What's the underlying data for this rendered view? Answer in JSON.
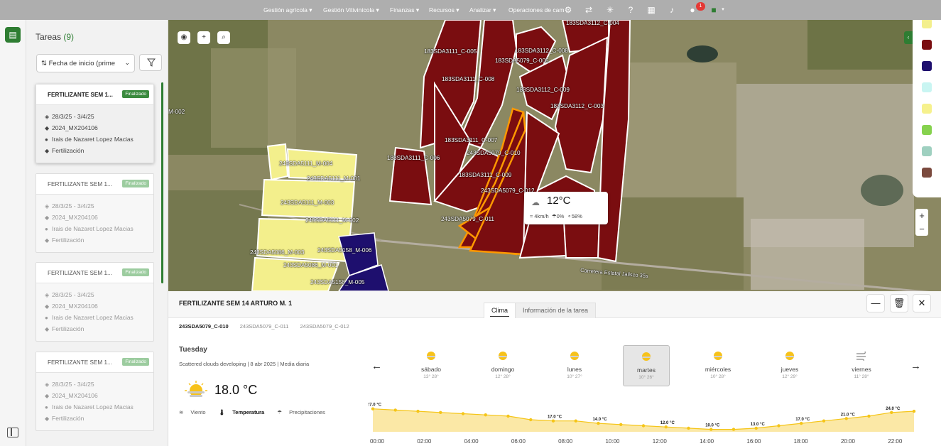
{
  "nav": {
    "items": [
      "Gestión agrícola",
      "Gestión Vitivinícola",
      "Finanzas",
      "Recursos",
      "Analizar",
      "Operaciones de cam"
    ],
    "notification_count": "1"
  },
  "tasks": {
    "title": "Tareas",
    "count": "(9)",
    "sort_label": "Fecha de inicio (prime",
    "cards": [
      {
        "name": "FERTILIZANTE SEM 1...",
        "status": "Finalizado",
        "dates": "28/3/25 - 3/4/25",
        "code": "2024_MX204106",
        "person": "Irais de Nazaret Lopez Macias",
        "type": "Fertilización"
      },
      {
        "name": "FERTILIZANTE SEM 1...",
        "status": "Finalizado",
        "dates": "28/3/25 - 3/4/25",
        "code": "2024_MX204106",
        "person": "Irais de Nazaret Lopez Macias",
        "type": "Fertilización"
      },
      {
        "name": "FERTILIZANTE SEM 1...",
        "status": "Finalizado",
        "dates": "28/3/25 - 3/4/25",
        "code": "2024_MX204106",
        "person": "Irais de Nazaret Lopez Macias",
        "type": "Fertilización"
      },
      {
        "name": "FERTILIZANTE SEM 1...",
        "status": "Finalizado",
        "dates": "28/3/25 - 3/4/25",
        "code": "2024_MX204106",
        "person": "Irais de Nazaret Lopez Macias",
        "type": "Fertilización"
      }
    ]
  },
  "map": {
    "labels": [
      "183SDA3112_C-004",
      "183SDA3111_C-005",
      "183SDA3112_C-008",
      "183SDA5079_C-005",
      "183SDA3111_C-008",
      "183SDA3112_C-009",
      "183SDA3112_C-003",
      "183SDA3111_C-007",
      "243SDA5079_C-010",
      "183SDA3111_C-006",
      "183SDA3111_C-009",
      "243SDA5079_C-012",
      "243SDA5079_C-011",
      "243SDA5111_M-004",
      "243SDA5111_M-001",
      "243SDA5111_M-003",
      "243SDA5111_M-002",
      "243SDA5086_M-003",
      "243SDA5158_M-006",
      "243SDA5086_M-001",
      "243SDA5158_M-005",
      "Carretera Estatal Jalisco 35s",
      "M-002"
    ],
    "legend_colors": [
      "#f3ef8c",
      "#7a0d10",
      "#1e0f6e",
      "#c9f5f2",
      "#f6f18d",
      "#86d24e",
      "#9fd0c0",
      "#7b4a3e"
    ],
    "weather": {
      "temp": "12°C",
      "wind": "4km/h",
      "rain": "0%",
      "humidity": "58%"
    }
  },
  "detail": {
    "title": "FERTILIZANTE SEM 14 ARTURO M. 1",
    "tabs": [
      "Clima",
      "Información de la tarea"
    ],
    "plots": [
      "243SDA5079_C-010",
      "243SDA5079_C-011",
      "243SDA5079_C-012"
    ],
    "day_name": "Tuesday",
    "description": "Scattered clouds developing | 8 abr 2025 | Media diaria",
    "current_temp": "18.0 °C",
    "metrics": [
      "Viento",
      "Temperatura",
      "Precipitaciones"
    ],
    "days": [
      {
        "name": "sábado",
        "range": "13° 28°"
      },
      {
        "name": "domingo",
        "range": "12° 28°"
      },
      {
        "name": "lunes",
        "range": "10° 27°"
      },
      {
        "name": "martes",
        "range": "10° 26°"
      },
      {
        "name": "miércoles",
        "range": "10° 28°"
      },
      {
        "name": "jueves",
        "range": "12° 29°"
      },
      {
        "name": "viernes",
        "range": "11° 28°"
      }
    ]
  },
  "chart_data": {
    "type": "area",
    "x": [
      "00:00",
      "01:00",
      "02:00",
      "03:00",
      "04:00",
      "05:00",
      "06:00",
      "07:00",
      "08:00",
      "09:00",
      "10:00",
      "11:00",
      "12:00",
      "13:00",
      "14:00",
      "15:00",
      "16:00",
      "17:00",
      "18:00",
      "19:00",
      "20:00",
      "21:00",
      "22:00",
      "23:00"
    ],
    "x_ticks": [
      "00:00",
      "02:00",
      "04:00",
      "06:00",
      "08:00",
      "10:00",
      "12:00",
      "14:00",
      "16:00",
      "18:00",
      "20:00",
      "22:00"
    ],
    "values": [
      27,
      26,
      25,
      24,
      23,
      22,
      21,
      18,
      17,
      17,
      15,
      14,
      13,
      12,
      11,
      10,
      10,
      11,
      13,
      15,
      17,
      19,
      21,
      24,
      25
    ],
    "point_labels": [
      "27.0 °C",
      "17.0 °C",
      "14.0 °C",
      "12.0 °C",
      "10.0 °C",
      "13.0 °C",
      "17.0 °C",
      "21.0 °C",
      "24.0 °C"
    ],
    "series_color": "#f5c518",
    "fill_color": "#fbe8a6"
  }
}
